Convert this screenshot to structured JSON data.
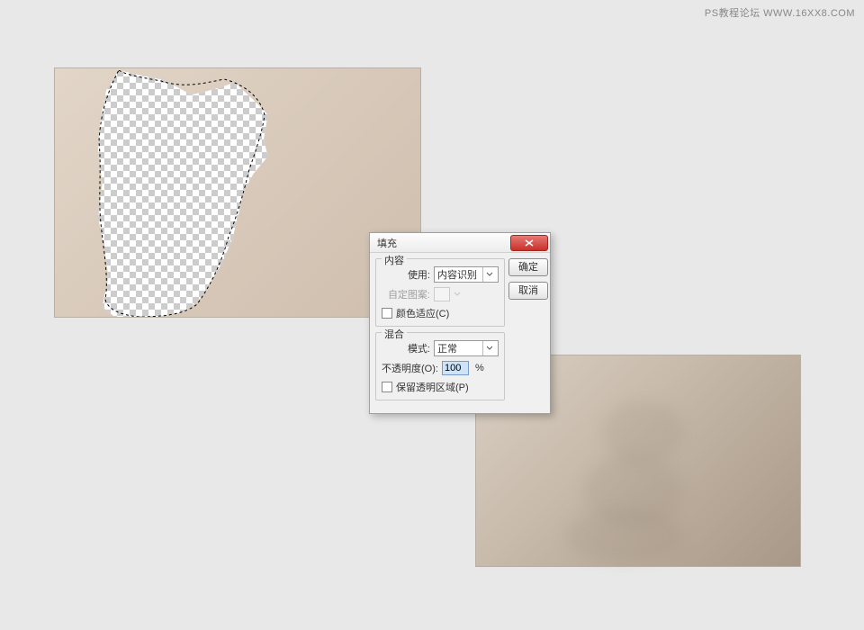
{
  "watermark": "PS教程论坛 WWW.16XX8.COM",
  "dialog": {
    "title": "填充",
    "ok": "确定",
    "cancel": "取消",
    "group_content": {
      "title": "内容",
      "use_label": "使用:",
      "use_value": "内容识别",
      "pattern_label": "自定图案:",
      "color_adapt_label": "颜色适应(C)"
    },
    "group_blend": {
      "title": "混合",
      "mode_label": "模式:",
      "mode_value": "正常",
      "opacity_label": "不透明度(O):",
      "opacity_value": "100",
      "opacity_pct": "%",
      "preserve_label": "保留透明区域(P)"
    }
  }
}
